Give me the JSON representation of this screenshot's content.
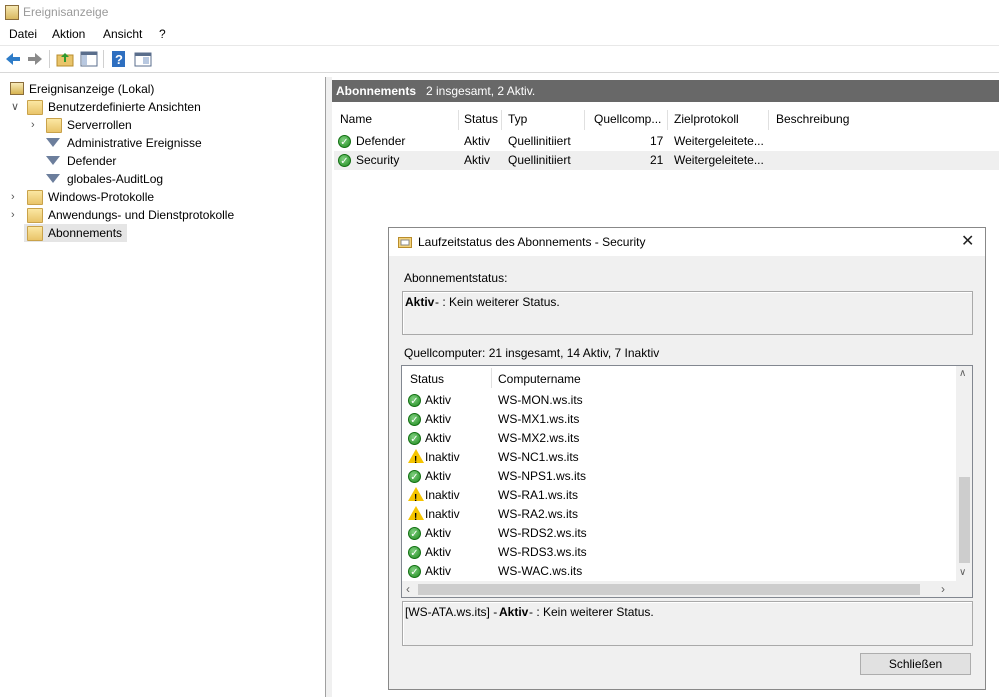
{
  "window": {
    "title": "Ereignisanzeige"
  },
  "menu": [
    "Datei",
    "Aktion",
    "Ansicht",
    "?"
  ],
  "toolbar": {
    "icons": [
      "back-arrow-icon",
      "forward-arrow-icon",
      "folder-up-icon",
      "show-hide-tree-icon",
      "help-icon",
      "properties-icon"
    ]
  },
  "tree": {
    "root": "Ereignisanzeige (Lokal)",
    "custom_views": "Benutzerdefinierte Ansichten",
    "server_roles": "Serverrollen",
    "admin_events": "Administrative Ereignisse",
    "defender": "Defender",
    "audit_log": "globales-AuditLog",
    "windows_logs": "Windows-Protokolle",
    "app_service_logs": "Anwendungs- und Dienstprotokolle",
    "subscriptions": "Abonnements"
  },
  "main": {
    "header_title": "Abonnements",
    "header_summary": "2 insgesamt, 2 Aktiv.",
    "columns": [
      "Name",
      "Status",
      "Typ",
      "Quellcomp...",
      "Zielprotokoll",
      "Beschreibung"
    ],
    "rows": [
      {
        "name": "Defender",
        "status": "Aktiv",
        "type": "Quellinitiiert",
        "count": "17",
        "target": "Weitergeleitete...",
        "desc": ""
      },
      {
        "name": "Security",
        "status": "Aktiv",
        "type": "Quellinitiiert",
        "count": "21",
        "target": "Weitergeleitete...",
        "desc": ""
      }
    ]
  },
  "dialog": {
    "title": "Laufzeitstatus des Abonnements - Security",
    "status_label": "Abonnementstatus:",
    "status_bold": "Aktiv",
    "status_text": " - : Kein weiterer Status.",
    "source_label": "Quellcomputer: 21 insgesamt, 14 Aktiv, 7 Inaktiv",
    "list_columns": [
      "Status",
      "Computername"
    ],
    "list_rows": [
      {
        "state": "ok",
        "status": "Aktiv",
        "name": "WS-MON.ws.its"
      },
      {
        "state": "ok",
        "status": "Aktiv",
        "name": "WS-MX1.ws.its"
      },
      {
        "state": "ok",
        "status": "Aktiv",
        "name": "WS-MX2.ws.its"
      },
      {
        "state": "warn",
        "status": "Inaktiv",
        "name": "WS-NC1.ws.its"
      },
      {
        "state": "ok",
        "status": "Aktiv",
        "name": "WS-NPS1.ws.its"
      },
      {
        "state": "warn",
        "status": "Inaktiv",
        "name": "WS-RA1.ws.its"
      },
      {
        "state": "warn",
        "status": "Inaktiv",
        "name": "WS-RA2.ws.its"
      },
      {
        "state": "ok",
        "status": "Aktiv",
        "name": "WS-RDS2.ws.its"
      },
      {
        "state": "ok",
        "status": "Aktiv",
        "name": "WS-RDS3.ws.its"
      },
      {
        "state": "ok",
        "status": "Aktiv",
        "name": "WS-WAC.ws.its"
      }
    ],
    "detail_prefix": "[WS-ATA.ws.its] - ",
    "detail_bold": "Aktiv",
    "detail_text": " - : Kein weiterer Status.",
    "close_label": "Schließen"
  },
  "colors": {
    "header_bg": "#686868",
    "ok": "#1f8a1f",
    "warn": "#f5c400"
  }
}
